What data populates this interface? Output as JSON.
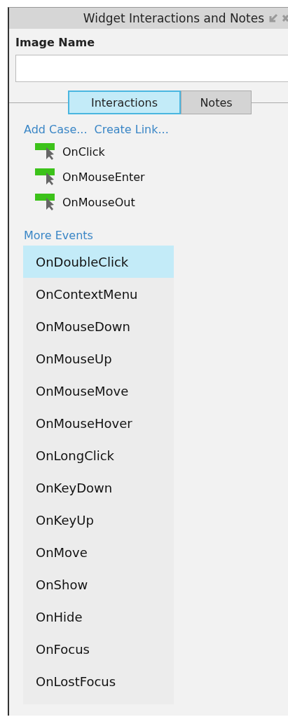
{
  "panel": {
    "title": "Widget Interactions and Notes"
  },
  "image_name": {
    "label": "Image Name"
  },
  "tabs": [
    {
      "label": "Interactions",
      "selected": true
    },
    {
      "label": "Notes",
      "selected": false
    }
  ],
  "links": [
    "Add Case...",
    "Create Link..."
  ],
  "events": [
    "OnClick",
    "OnMouseEnter",
    "OnMouseOut"
  ],
  "more_events": {
    "title": "More Events",
    "items": [
      {
        "label": "OnDoubleClick",
        "selected": true
      },
      {
        "label": "OnContextMenu",
        "selected": false
      },
      {
        "label": "OnMouseDown",
        "selected": false
      },
      {
        "label": "OnMouseUp",
        "selected": false
      },
      {
        "label": "OnMouseMove",
        "selected": false
      },
      {
        "label": "OnMouseHover",
        "selected": false
      },
      {
        "label": "OnLongClick",
        "selected": false
      },
      {
        "label": "OnKeyDown",
        "selected": false
      },
      {
        "label": "OnKeyUp",
        "selected": false
      },
      {
        "label": "OnMove",
        "selected": false
      },
      {
        "label": "OnShow",
        "selected": false
      },
      {
        "label": "OnHide",
        "selected": false
      },
      {
        "label": "OnFocus",
        "selected": false
      },
      {
        "label": "OnLostFocus",
        "selected": false
      }
    ]
  }
}
